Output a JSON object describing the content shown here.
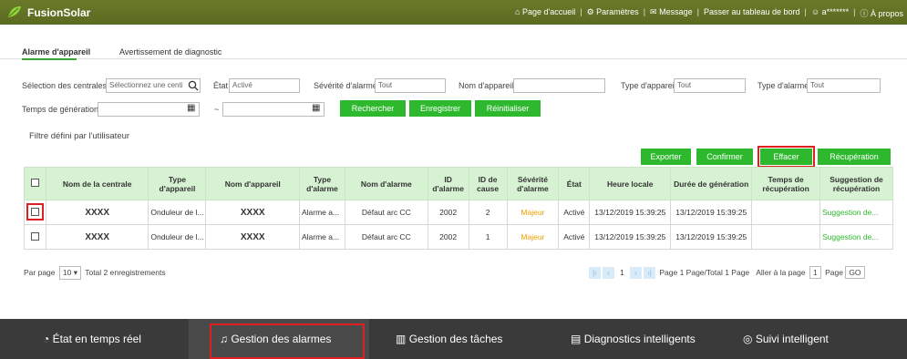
{
  "header": {
    "brand": "FusionSolar",
    "nav": [
      "Page d'accueil",
      "Paramètres",
      "Message",
      "Passer au tableau de bord",
      "a*******",
      "À propos"
    ]
  },
  "tabs": [
    {
      "label": "Alarme d'appareil"
    },
    {
      "label": "Avertissement de diagnostic"
    }
  ],
  "filters": {
    "plants_label": "Sélection des centrales",
    "plants_placeholder": "Sélectionnez une centi",
    "state_label": "État",
    "state_value": "Activé",
    "severity_label": "Sévérité d'alarme",
    "severity_value": "Tout",
    "device_name_label": "Nom d'appareil",
    "device_type_label": "Type d'appareil",
    "device_type_value": "Tout",
    "alarm_type_label": "Type d'alarme",
    "alarm_type_value": "Tout",
    "gen_time_label": "Temps de génération",
    "range_sep": "~"
  },
  "buttons": {
    "search": "Rechercher",
    "save": "Enregistrer",
    "reset": "Réinitialiser",
    "export": "Exporter",
    "confirm": "Confirmer",
    "clear": "Effacer",
    "recover": "Récupération"
  },
  "custom_filter_label": "Filtre défini par l'utilisateur",
  "table": {
    "headers": [
      "Nom de la centrale",
      "Type d'appareil",
      "Nom d'appareil",
      "Type d'alarme",
      "Nom d'alarme",
      "ID d'alarme",
      "ID de cause",
      "Sévérité d'alarme",
      "État",
      "Heure locale",
      "Durée de génération",
      "Temps de récupération",
      "Suggestion de récupération"
    ],
    "rows": [
      [
        "XXXX",
        "Onduleur de l...",
        "XXXX",
        "Alarme a...",
        "Défaut arc CC",
        "2002",
        "2",
        "Majeur",
        "Activé",
        "13/12/2019 15:39:25",
        "13/12/2019 15:39:25",
        "",
        "Suggestion de..."
      ],
      [
        "XXXX",
        "Onduleur de l...",
        "XXXX",
        "Alarme a...",
        "Défaut arc CC",
        "2002",
        "1",
        "Majeur",
        "Activé",
        "13/12/2019 15:39:25",
        "13/12/2019 15:39:25",
        "",
        "Suggestion de..."
      ]
    ]
  },
  "pager": {
    "per_page_label": "Par page",
    "per_page_value": "10",
    "total": "Total 2 enregistrements",
    "current_page": "1",
    "page_info": "Page 1 Page/Total 1 Page",
    "goto_label": "Aller à la page",
    "goto_value": "1",
    "page_word": "Page",
    "go": "GO"
  },
  "bottom_nav": [
    {
      "label": "État en temps réel",
      "icon": "gauge-icon"
    },
    {
      "label": "Gestion des alarmes",
      "icon": "bell-icon"
    },
    {
      "label": "Gestion des tâches",
      "icon": "tasks-icon"
    },
    {
      "label": "Diagnostics intelligents",
      "icon": "diagnostic-icon"
    },
    {
      "label": "Suivi intelligent",
      "icon": "tracking-icon"
    }
  ],
  "colors": {
    "accent": "#2eb82e",
    "header": "#5f6e24",
    "highlight": "#e02020",
    "severity_major": "#f0a000"
  }
}
